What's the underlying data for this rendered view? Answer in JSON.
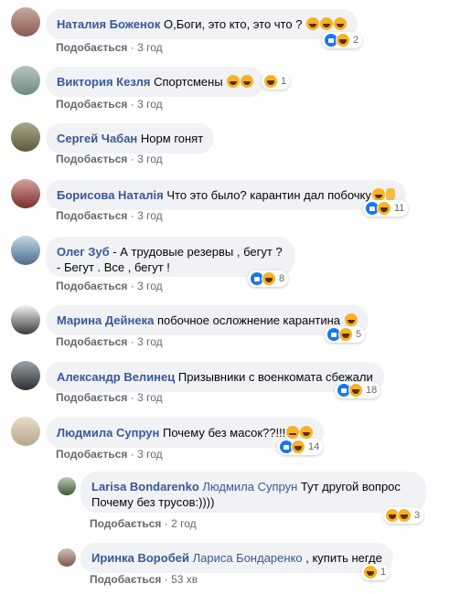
{
  "like_label": "Подобається",
  "sep": "·",
  "comments": [
    {
      "author": "Наталия Боженок",
      "text": "О,Боги, это кто, это что ?",
      "time": "3 год",
      "count": "2"
    },
    {
      "author": "Виктория Кезля",
      "text": "Спортсмены",
      "time": "3 год",
      "count": "1"
    },
    {
      "author": "Сергей Чабан",
      "text": "Норм гонят",
      "time": "3 год"
    },
    {
      "author": "Борисова Наталія",
      "text": "Что это было? карантин дал побочку",
      "time": "3 год",
      "count": "11"
    },
    {
      "author": "Олег Зуб",
      "text_line1": " - А трудовые резервы , бегут ?",
      "text_line2": "- Бегут . Все , бегут !",
      "time": "3 год",
      "count": "8"
    },
    {
      "author": "Марина Дейнека",
      "text": "побочное осложнение карантина",
      "time": "3 год",
      "count": "5"
    },
    {
      "author": "Александр Велинец",
      "text": "Призывники с военкомата сбежали",
      "time": "3 год",
      "count": "18"
    },
    {
      "author": "Людмила Супрун",
      "text": "Почему без масок??!!!",
      "time": "3 год",
      "count": "14"
    },
    {
      "author": "Larisa Bondarenko",
      "mention": "Людмила Супрун",
      "text_line1": " Тут другой вопрос",
      "text_line2": "Почему без трусов:))))",
      "time": "2 год",
      "count": "3"
    },
    {
      "author": "Иринка Воробей",
      "mention": "Лариса Бондаренко",
      "text": " , купить негде",
      "time": "53 хв",
      "count": "1"
    }
  ],
  "icons": {
    "like": "like-reaction-icon",
    "haha": "haha-reaction-icon"
  },
  "colors": {
    "author": "#385898",
    "bubble": "#f0f2f5",
    "meta": "#65676b",
    "like": "#1877f2",
    "haha": "#f7b125"
  }
}
